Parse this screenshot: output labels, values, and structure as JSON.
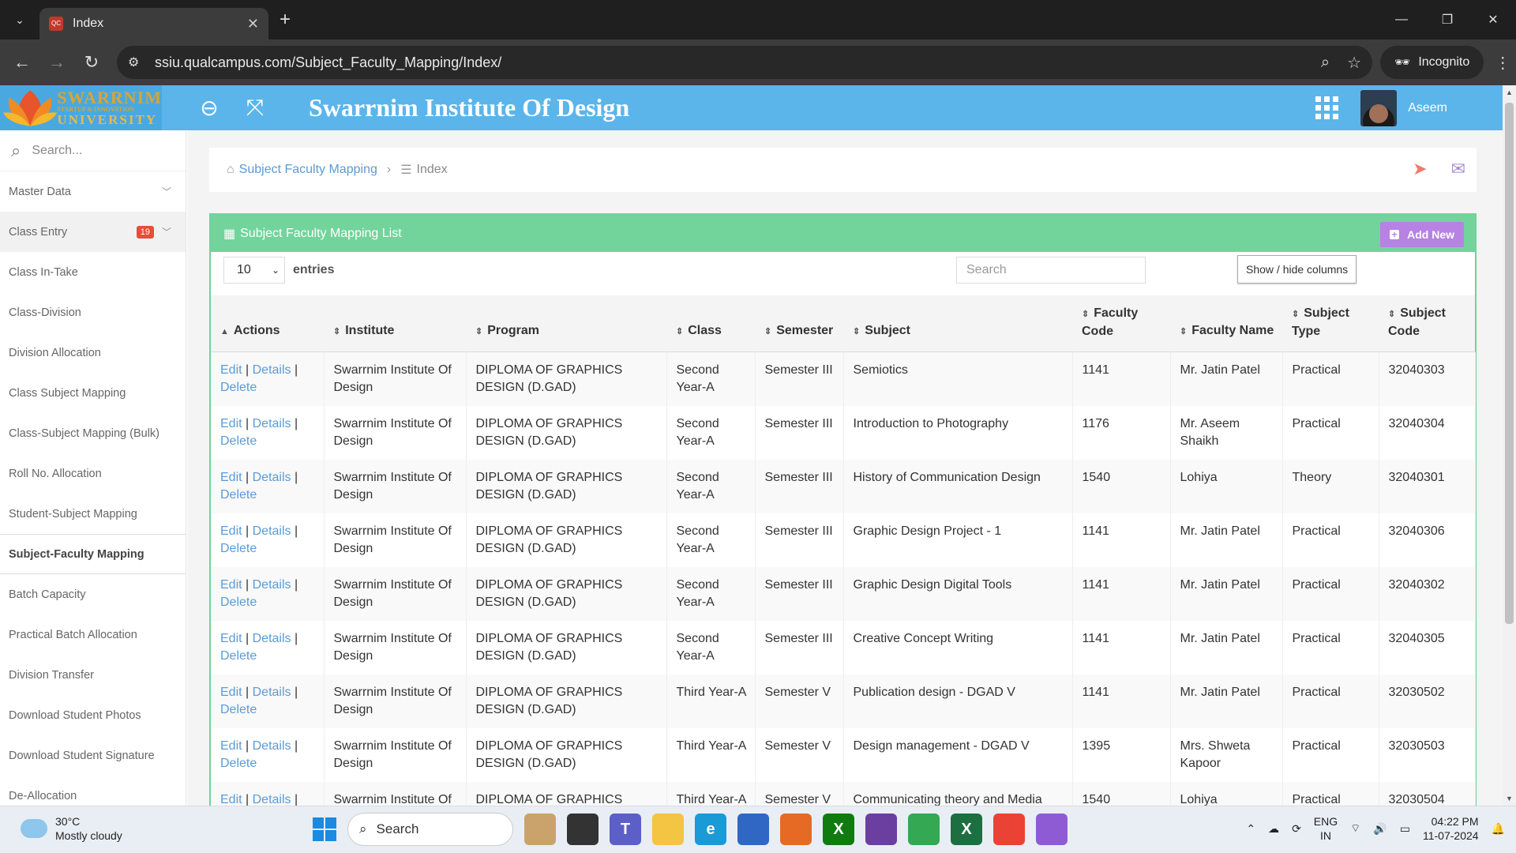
{
  "browser": {
    "tab_title": "Index",
    "tab_favicon_text": "Qual Campus",
    "url": "ssiu.qualcampus.com/Subject_Faculty_Mapping/Index/",
    "incognito_label": "Incognito"
  },
  "header": {
    "logo_line1": "SWARRNIM",
    "logo_line2": "STARTUP & INNOVATION",
    "logo_line3": "UNIVERSITY",
    "title": "Swarrnim Institute Of Design",
    "user_name": "Aseem"
  },
  "sidebar": {
    "search_placeholder": "Search...",
    "items": [
      {
        "label": "Master Data"
      },
      {
        "label": "Class Entry",
        "badge": "19"
      },
      {
        "label": "Class In-Take"
      },
      {
        "label": "Class-Division"
      },
      {
        "label": "Division Allocation"
      },
      {
        "label": "Class Subject Mapping"
      },
      {
        "label": "Class-Subject Mapping (Bulk)"
      },
      {
        "label": "Roll No. Allocation"
      },
      {
        "label": "Student-Subject Mapping"
      },
      {
        "label": "Subject-Faculty Mapping"
      },
      {
        "label": "Batch Capacity"
      },
      {
        "label": "Practical Batch Allocation"
      },
      {
        "label": "Division Transfer"
      },
      {
        "label": "Download Student Photos"
      },
      {
        "label": "Download Student Signature"
      },
      {
        "label": "De-Allocation"
      }
    ]
  },
  "breadcrumb": {
    "parent": "Subject Faculty Mapping",
    "current": "Index"
  },
  "panel": {
    "title": "Subject Faculty Mapping List",
    "add_label": "Add New",
    "page_length": "10",
    "entries_label": "entries",
    "search_placeholder": "Search",
    "show_hide_label": "Show / hide columns"
  },
  "table": {
    "headers": [
      "Actions",
      "Institute",
      "Program",
      "Class",
      "Semester",
      "Subject",
      "Faculty Code",
      "Faculty Name",
      "Subject Type",
      "Subject Code"
    ],
    "action_labels": {
      "edit": "Edit",
      "details": "Details",
      "delete": "Delete"
    },
    "rows": [
      {
        "institute": "Swarrnim Institute Of Design",
        "program": "DIPLOMA OF GRAPHICS DESIGN (D.GAD)",
        "class": "Second Year-A",
        "semester": "Semester III",
        "subject": "Semiotics",
        "faculty_code": "1141",
        "faculty_name": "Mr. Jatin Patel",
        "subject_type": "Practical",
        "subject_code": "32040303"
      },
      {
        "institute": "Swarrnim Institute Of Design",
        "program": "DIPLOMA OF GRAPHICS DESIGN (D.GAD)",
        "class": "Second Year-A",
        "semester": "Semester III",
        "subject": "Introduction to Photography",
        "faculty_code": "1176",
        "faculty_name": "Mr. Aseem Shaikh",
        "subject_type": "Practical",
        "subject_code": "32040304"
      },
      {
        "institute": "Swarrnim Institute Of Design",
        "program": "DIPLOMA OF GRAPHICS DESIGN (D.GAD)",
        "class": "Second Year-A",
        "semester": "Semester III",
        "subject": "History of Communication Design",
        "faculty_code": "1540",
        "faculty_name": "Lohiya",
        "subject_type": "Theory",
        "subject_code": "32040301"
      },
      {
        "institute": "Swarrnim Institute Of Design",
        "program": "DIPLOMA OF GRAPHICS DESIGN (D.GAD)",
        "class": "Second Year-A",
        "semester": "Semester III",
        "subject": "Graphic Design Project - 1",
        "faculty_code": "1141",
        "faculty_name": "Mr. Jatin Patel",
        "subject_type": "Practical",
        "subject_code": "32040306"
      },
      {
        "institute": "Swarrnim Institute Of Design",
        "program": "DIPLOMA OF GRAPHICS DESIGN (D.GAD)",
        "class": "Second Year-A",
        "semester": "Semester III",
        "subject": "Graphic Design Digital Tools",
        "faculty_code": "1141",
        "faculty_name": "Mr. Jatin Patel",
        "subject_type": "Practical",
        "subject_code": "32040302"
      },
      {
        "institute": "Swarrnim Institute Of Design",
        "program": "DIPLOMA OF GRAPHICS DESIGN (D.GAD)",
        "class": "Second Year-A",
        "semester": "Semester III",
        "subject": "Creative Concept Writing",
        "faculty_code": "1141",
        "faculty_name": "Mr. Jatin Patel",
        "subject_type": "Practical",
        "subject_code": "32040305"
      },
      {
        "institute": "Swarrnim Institute Of Design",
        "program": "DIPLOMA OF GRAPHICS DESIGN (D.GAD)",
        "class": "Third Year-A",
        "semester": "Semester V",
        "subject": "Publication design - DGAD V",
        "faculty_code": "1141",
        "faculty_name": "Mr. Jatin Patel",
        "subject_type": "Practical",
        "subject_code": "32030502"
      },
      {
        "institute": "Swarrnim Institute Of Design",
        "program": "DIPLOMA OF GRAPHICS DESIGN (D.GAD)",
        "class": "Third Year-A",
        "semester": "Semester V",
        "subject": "Design management - DGAD V",
        "faculty_code": "1395",
        "faculty_name": "Mrs. Shweta Kapoor",
        "subject_type": "Practical",
        "subject_code": "32030503"
      },
      {
        "institute": "Swarrnim Institute Of Design",
        "program": "DIPLOMA OF GRAPHICS",
        "class": "Third Year-A",
        "semester": "Semester V",
        "subject": "Communicating theory and Media",
        "faculty_code": "1540",
        "faculty_name": "Lohiya",
        "subject_type": "Practical",
        "subject_code": "32030504"
      }
    ]
  },
  "taskbar": {
    "temperature": "30°C",
    "weather": "Mostly cloudy",
    "search_label": "Search",
    "lang1": "ENG",
    "lang2": "IN",
    "time": "04:22 PM",
    "date": "11-07-2024"
  },
  "colors": {
    "header_bg": "#5bb5ea",
    "panel_accent": "#72d49b",
    "add_button": "#b782e3",
    "link": "#5b9bd5",
    "badge": "#e74c3c"
  }
}
